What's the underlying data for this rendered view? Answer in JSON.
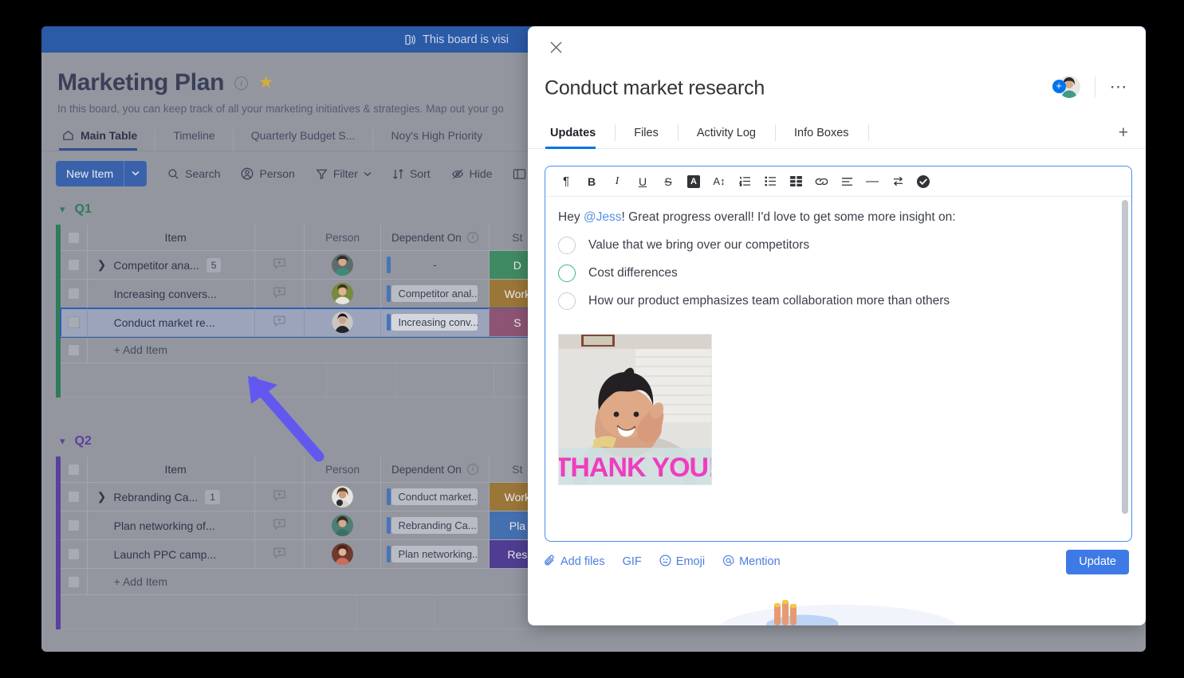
{
  "board": {
    "banner": {
      "text": "This board is visi",
      "icon": "board-visibility-icon"
    },
    "title": "Marketing Plan",
    "description": "In this board, you can keep track of all your marketing initiatives & strategies. Map out your go",
    "tabs": [
      {
        "label": "Main Table",
        "icon": "home-icon",
        "active": true
      },
      {
        "label": "Timeline",
        "active": false
      },
      {
        "label": "Quarterly Budget S...",
        "active": false
      },
      {
        "label": "Noy's High Priority",
        "active": false
      }
    ],
    "toolbar": {
      "new_item": "New Item",
      "new_item_caret": "⌄",
      "search": "Search",
      "person": "Person",
      "filter": "Filter",
      "filter_caret": "⌄",
      "sort": "Sort",
      "hide": "Hide"
    },
    "columns": [
      "Item",
      "Person",
      "Dependent On",
      "St"
    ],
    "add_item_label": "+ Add Item",
    "groups": [
      {
        "name": "Q1",
        "color": "#2f7a5a",
        "rows": [
          {
            "item": "Competitor ana...",
            "expandable": true,
            "count": "5",
            "dependent": "-",
            "status": "D",
            "status_class": "st-done",
            "selected": false
          },
          {
            "item": "Increasing convers...",
            "expandable": false,
            "count": "",
            "dependent": "Competitor anal...",
            "status": "Work",
            "status_class": "st-work",
            "selected": false
          },
          {
            "item": "Conduct market re...",
            "expandable": false,
            "count": "",
            "dependent": "Increasing conv...",
            "status": "S",
            "status_class": "st-stuck",
            "selected": true
          }
        ]
      },
      {
        "name": "Q2",
        "color": "#5b3f9d",
        "rows": [
          {
            "item": "Rebranding Ca...",
            "expandable": true,
            "count": "1",
            "dependent": "Conduct market...",
            "status": "Work",
            "status_class": "st-work",
            "selected": false
          },
          {
            "item": "Plan networking of...",
            "expandable": false,
            "count": "",
            "dependent": "Rebranding Ca...",
            "status": "Pla",
            "status_class": "st-plan",
            "selected": false
          },
          {
            "item": "Launch PPC camp...",
            "expandable": false,
            "count": "",
            "dependent": "Plan networking...",
            "status": "Res",
            "status_class": "st-res",
            "selected": false
          }
        ]
      }
    ]
  },
  "modal": {
    "close_icon": "close-icon",
    "title": "Conduct market research",
    "menu_icon": "more-options-icon",
    "add_subscriber_icon": "add-subscriber-icon",
    "tabs": [
      {
        "label": "Updates",
        "active": true
      },
      {
        "label": "Files",
        "active": false
      },
      {
        "label": "Activity Log",
        "active": false
      },
      {
        "label": "Info Boxes",
        "active": false
      }
    ],
    "tab_add": "+",
    "editor": {
      "toolbar": [
        {
          "name": "paragraph-icon",
          "glyph": "¶"
        },
        {
          "name": "bold-icon",
          "glyph": "B"
        },
        {
          "name": "italic-icon",
          "glyph": "I"
        },
        {
          "name": "underline-icon",
          "glyph": "U"
        },
        {
          "name": "strikethrough-icon",
          "glyph": "S"
        },
        {
          "name": "text-color-icon",
          "glyph": "A"
        },
        {
          "name": "font-size-icon",
          "glyph": "A↕"
        },
        {
          "name": "numbered-list-icon",
          "glyph": ""
        },
        {
          "name": "bulleted-list-icon",
          "glyph": ""
        },
        {
          "name": "table-icon",
          "glyph": ""
        },
        {
          "name": "link-icon",
          "glyph": ""
        },
        {
          "name": "align-icon",
          "glyph": ""
        },
        {
          "name": "horizontal-rule-icon",
          "glyph": "—"
        },
        {
          "name": "indent-icon",
          "glyph": ""
        },
        {
          "name": "checklist-icon",
          "glyph": ""
        }
      ],
      "greeting_prefix": "Hey ",
      "mention": "@Jess",
      "greeting_suffix": "! Great progress overall! I'd love to get some more insight on:",
      "todos": [
        {
          "text": "Value that we bring over our competitors",
          "state": "empty"
        },
        {
          "text": "Cost differences",
          "state": "hover-green"
        },
        {
          "text": "How our product emphasizes team collaboration more than others",
          "state": "empty"
        }
      ],
      "attachment": {
        "name": "thank-you-gif",
        "caption": "THANK YOU!"
      }
    },
    "actions": [
      {
        "label": "Add files",
        "icon": "paperclip-icon"
      },
      {
        "label": "GIF",
        "icon": ""
      },
      {
        "label": "Emoji",
        "icon": "emoji-icon"
      },
      {
        "label": "Mention",
        "icon": "mention-icon"
      }
    ],
    "update_button": "Update"
  },
  "annotation": {
    "arrow": "pointer-arrow",
    "color": "#6258f0"
  },
  "colors": {
    "brand_blue": "#0073ea",
    "topbar_blue": "#2b5aa7",
    "accent_green": "#3fb27f",
    "arrow_purple": "#6258f0"
  }
}
